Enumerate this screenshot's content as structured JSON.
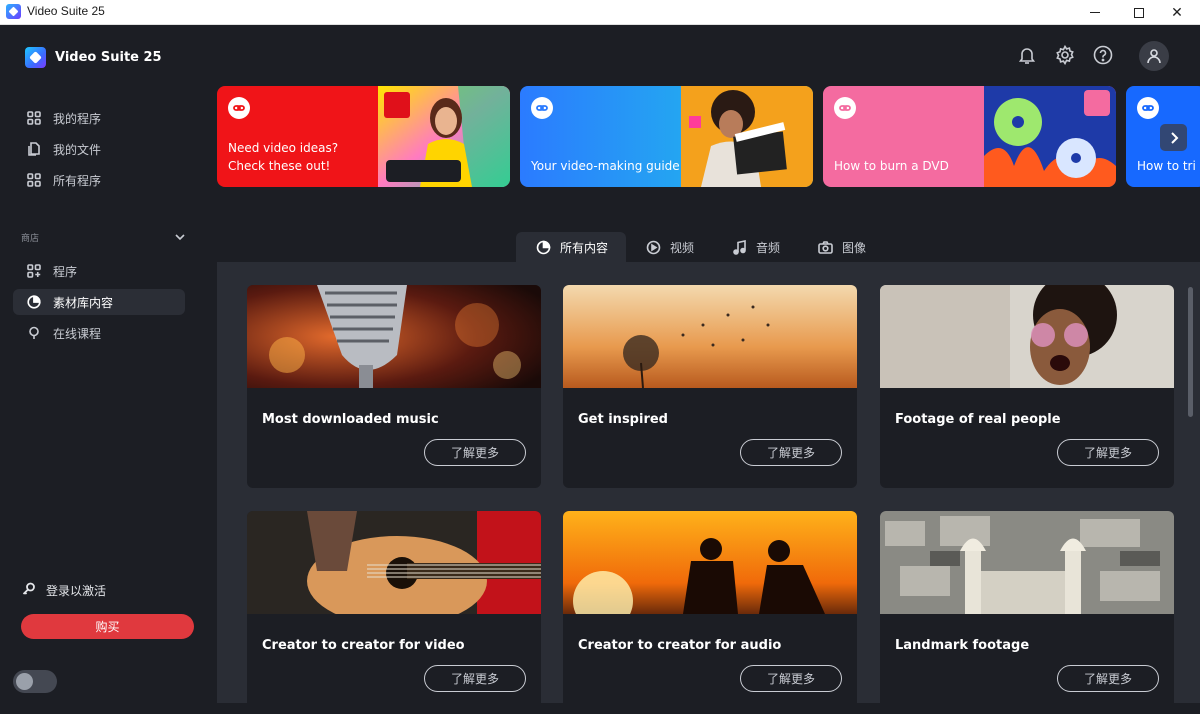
{
  "window": {
    "title": "Video Suite 25"
  },
  "brand": {
    "name": "Video Suite 25"
  },
  "sidebar": {
    "items": [
      {
        "label": "我的程序",
        "icon": "grid-icon"
      },
      {
        "label": "我的文件",
        "icon": "files-icon"
      },
      {
        "label": "所有程序",
        "icon": "grid-icon"
      }
    ],
    "store_section": "商店",
    "store_items": [
      {
        "label": "程序",
        "icon": "grid-plus-icon"
      },
      {
        "label": "素材库内容",
        "icon": "pie-icon",
        "active": true
      },
      {
        "label": "在线课程",
        "icon": "bulb-icon"
      }
    ],
    "login_label": "登录以激活",
    "buy_label": "购买"
  },
  "banners": [
    {
      "text": "Need video ideas? Check these out!",
      "color": "#f01418"
    },
    {
      "text": "Your video-making guide",
      "color": "#2b7bff"
    },
    {
      "text": "How to burn a DVD",
      "color": "#f46ba0"
    },
    {
      "text": "How to tri",
      "color": "#1769ff"
    }
  ],
  "tabs": [
    {
      "label": "所有内容",
      "icon": "pie-icon",
      "active": true
    },
    {
      "label": "视频",
      "icon": "play-circle-icon"
    },
    {
      "label": "音频",
      "icon": "music-note-icon"
    },
    {
      "label": "图像",
      "icon": "camera-icon"
    }
  ],
  "cards": [
    {
      "title": "Most downloaded music",
      "button": "了解更多"
    },
    {
      "title": "Get inspired",
      "button": "了解更多"
    },
    {
      "title": "Footage of real people",
      "button": "了解更多"
    },
    {
      "title": "Creator to creator for video",
      "button": "了解更多"
    },
    {
      "title": "Creator to creator for audio",
      "button": "了解更多"
    },
    {
      "title": "Landmark footage",
      "button": "了解更多"
    }
  ]
}
